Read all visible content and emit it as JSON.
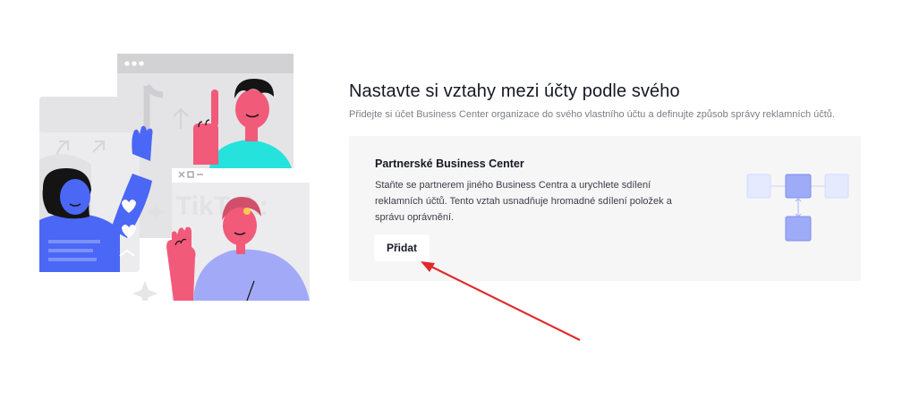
{
  "main": {
    "title": "Nastavte si vztahy mezi účty podle svého",
    "subtitle": "Přidejte si účet Business Center organizace do svého vlastního účtu a definujte způsob správy reklamních účtů."
  },
  "card": {
    "title": "Partnerské Business Center",
    "description": "Staňte se partnerem jiného Business Centra a urychlete sdílení reklamních účtů. Tento vztah usnadňuje hromadné sdílení položek a správu oprávnění.",
    "button_label": "Přidat"
  },
  "illustration": {
    "watermark_text": "TikTok:"
  },
  "colors": {
    "accent_blue": "#4a67f5",
    "cyan": "#25e2dc",
    "pink": "#f25a7a",
    "lavender": "#a2aaf7",
    "annotation_red": "#e02a2a"
  }
}
